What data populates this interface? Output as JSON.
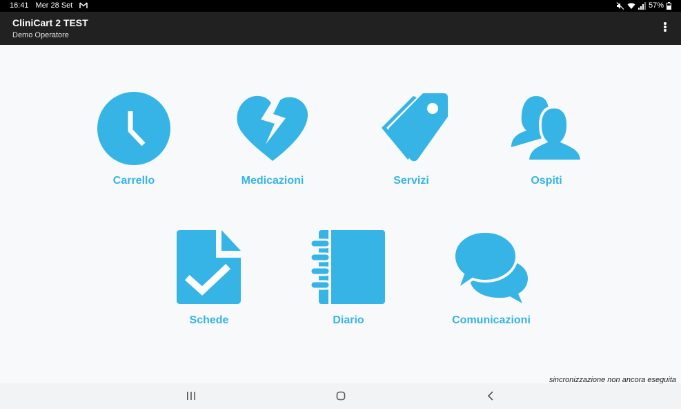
{
  "status_bar": {
    "time": "16:41",
    "date": "Mer 28 Set",
    "battery": "57%"
  },
  "app_bar": {
    "title": "CliniCart 2 TEST",
    "subtitle": "Demo Operatore"
  },
  "menu": [
    {
      "label": "Carrello",
      "icon": "clock-icon"
    },
    {
      "label": "Medicazioni",
      "icon": "broken-heart-icon"
    },
    {
      "label": "Servizi",
      "icon": "tags-icon"
    },
    {
      "label": "Ospiti",
      "icon": "users-icon"
    },
    {
      "label": "Schede",
      "icon": "checklist-document-icon"
    },
    {
      "label": "Diario",
      "icon": "notebook-icon"
    },
    {
      "label": "Comunicazioni",
      "icon": "chat-bubbles-icon"
    }
  ],
  "sync_status": "sincronizzazione non ancora eseguita",
  "colors": {
    "accent": "#35b4e5",
    "app_bar": "#212121",
    "background": "#f8f9fa"
  }
}
